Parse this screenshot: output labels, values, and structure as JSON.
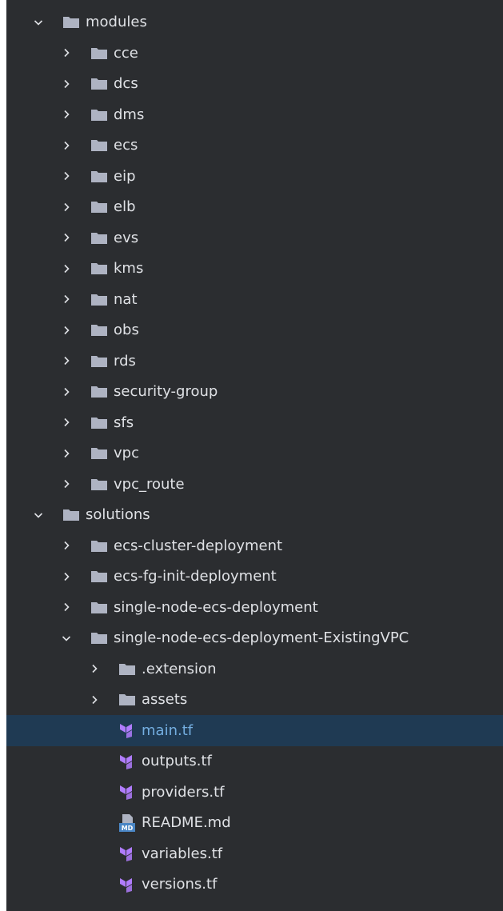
{
  "colors": {
    "panel_background": "#2b2d30",
    "text": "#dfe1e5",
    "folder_icon": "#aeb3c2",
    "selection_background": "#1f3a53",
    "selection_text": "#74aee0",
    "terraform_icon": "#b07cfd",
    "markdown_icon": "#4a86c5"
  },
  "tree": [
    {
      "label": "modules",
      "type": "folder",
      "expanded": true,
      "depth": 0
    },
    {
      "label": "cce",
      "type": "folder",
      "expanded": false,
      "depth": 1
    },
    {
      "label": "dcs",
      "type": "folder",
      "expanded": false,
      "depth": 1
    },
    {
      "label": "dms",
      "type": "folder",
      "expanded": false,
      "depth": 1
    },
    {
      "label": "ecs",
      "type": "folder",
      "expanded": false,
      "depth": 1
    },
    {
      "label": "eip",
      "type": "folder",
      "expanded": false,
      "depth": 1
    },
    {
      "label": "elb",
      "type": "folder",
      "expanded": false,
      "depth": 1
    },
    {
      "label": "evs",
      "type": "folder",
      "expanded": false,
      "depth": 1
    },
    {
      "label": "kms",
      "type": "folder",
      "expanded": false,
      "depth": 1
    },
    {
      "label": "nat",
      "type": "folder",
      "expanded": false,
      "depth": 1
    },
    {
      "label": "obs",
      "type": "folder",
      "expanded": false,
      "depth": 1
    },
    {
      "label": "rds",
      "type": "folder",
      "expanded": false,
      "depth": 1
    },
    {
      "label": "security-group",
      "type": "folder",
      "expanded": false,
      "depth": 1
    },
    {
      "label": "sfs",
      "type": "folder",
      "expanded": false,
      "depth": 1
    },
    {
      "label": "vpc",
      "type": "folder",
      "expanded": false,
      "depth": 1
    },
    {
      "label": "vpc_route",
      "type": "folder",
      "expanded": false,
      "depth": 1
    },
    {
      "label": "solutions",
      "type": "folder",
      "expanded": true,
      "depth": 0
    },
    {
      "label": "ecs-cluster-deployment",
      "type": "folder",
      "expanded": false,
      "depth": 1
    },
    {
      "label": "ecs-fg-init-deployment",
      "type": "folder",
      "expanded": false,
      "depth": 1
    },
    {
      "label": "single-node-ecs-deployment",
      "type": "folder",
      "expanded": false,
      "depth": 1
    },
    {
      "label": "single-node-ecs-deployment-ExistingVPC",
      "type": "folder",
      "expanded": true,
      "depth": 1
    },
    {
      "label": ".extension",
      "type": "folder",
      "expanded": false,
      "depth": 2
    },
    {
      "label": "assets",
      "type": "folder",
      "expanded": false,
      "depth": 2
    },
    {
      "label": "main.tf",
      "type": "terraform",
      "depth": 2,
      "selected": true
    },
    {
      "label": "outputs.tf",
      "type": "terraform",
      "depth": 2
    },
    {
      "label": "providers.tf",
      "type": "terraform",
      "depth": 2
    },
    {
      "label": "README.md",
      "type": "markdown",
      "depth": 2,
      "icon_text": "MD"
    },
    {
      "label": "variables.tf",
      "type": "terraform",
      "depth": 2
    },
    {
      "label": "versions.tf",
      "type": "terraform",
      "depth": 2
    }
  ]
}
